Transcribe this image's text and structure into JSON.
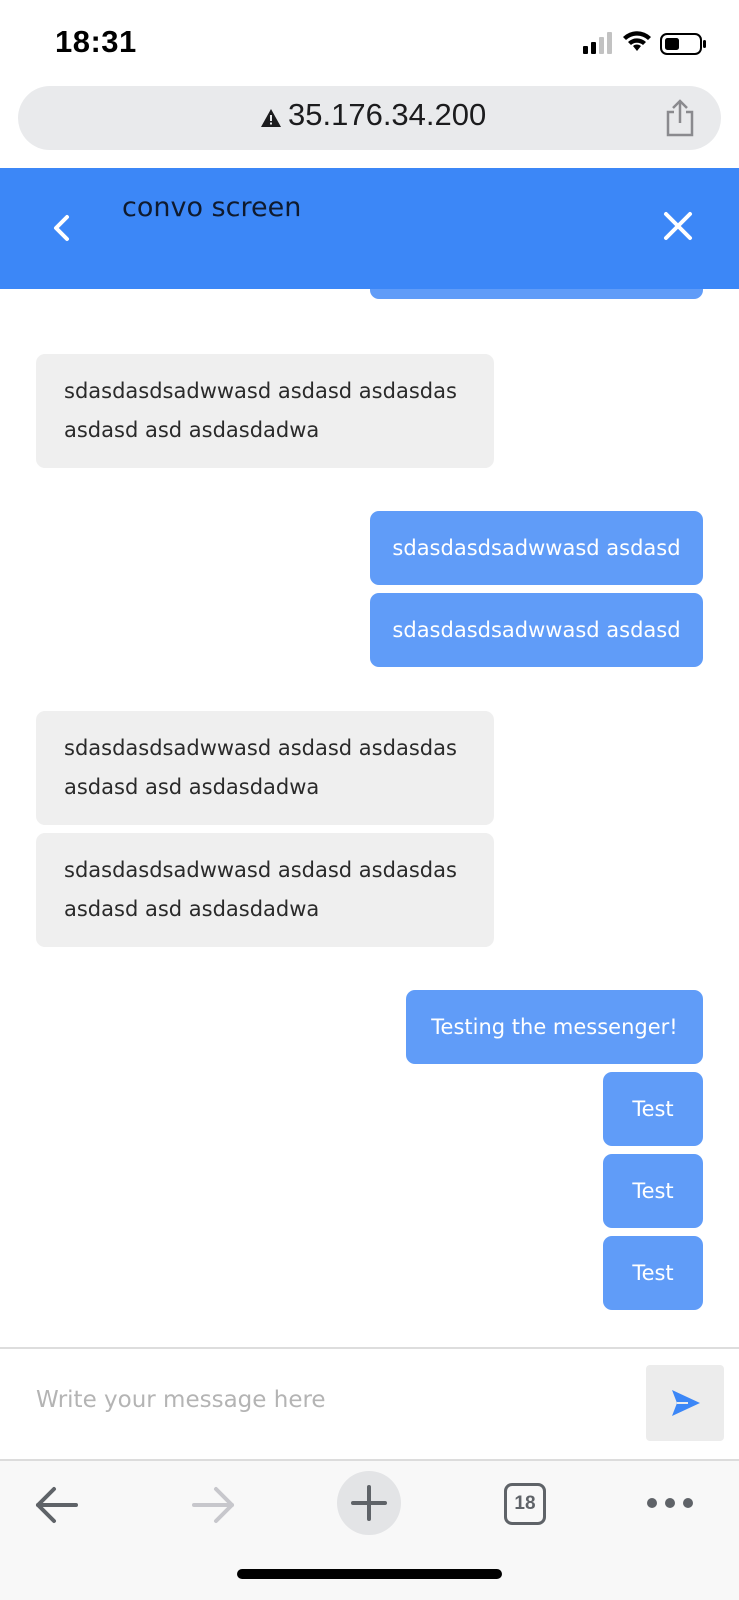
{
  "status_bar": {
    "time": "18:31",
    "icons": [
      "signal-icon",
      "wifi-icon",
      "battery-icon"
    ]
  },
  "browser": {
    "url": "35.176.34.200",
    "security_icon": "warning-icon",
    "share_icon": "share-icon",
    "open_tabs_count": "18",
    "toolbar_icons": [
      "back-arrow-icon",
      "forward-arrow-icon",
      "plus-icon",
      "tabs-icon",
      "more-icon"
    ]
  },
  "header": {
    "title": "convo screen",
    "back_icon": "chevron-left-icon",
    "close_icon": "close-icon",
    "color": "#3c87f7"
  },
  "messages": [
    {
      "direction": "sent",
      "text": ""
    },
    {
      "direction": "received",
      "text": "sdasdasdsadwwasd asdasd asdasdas asdasd asd asdasdadwa"
    },
    {
      "direction": "sent",
      "text": "sdasdasdsadwwasd asdasd"
    },
    {
      "direction": "sent",
      "text": "sdasdasdsadwwasd asdasd"
    },
    {
      "direction": "received",
      "text": "sdasdasdsadwwasd asdasd asdasdas asdasd asd asdasdadwa"
    },
    {
      "direction": "received",
      "text": "sdasdasdsadwwasd asdasd asdasdas asdasd asd asdasdadwa"
    },
    {
      "direction": "sent",
      "text": "Testing the messenger!"
    },
    {
      "direction": "sent",
      "text": "Test"
    },
    {
      "direction": "sent",
      "text": "Test"
    },
    {
      "direction": "sent",
      "text": "Test"
    }
  ],
  "composer": {
    "placeholder": "Write your message here",
    "value": "",
    "send_icon": "send-icon"
  },
  "colors": {
    "sent_bubble": "#609cf8",
    "received_bubble": "#efefef"
  }
}
